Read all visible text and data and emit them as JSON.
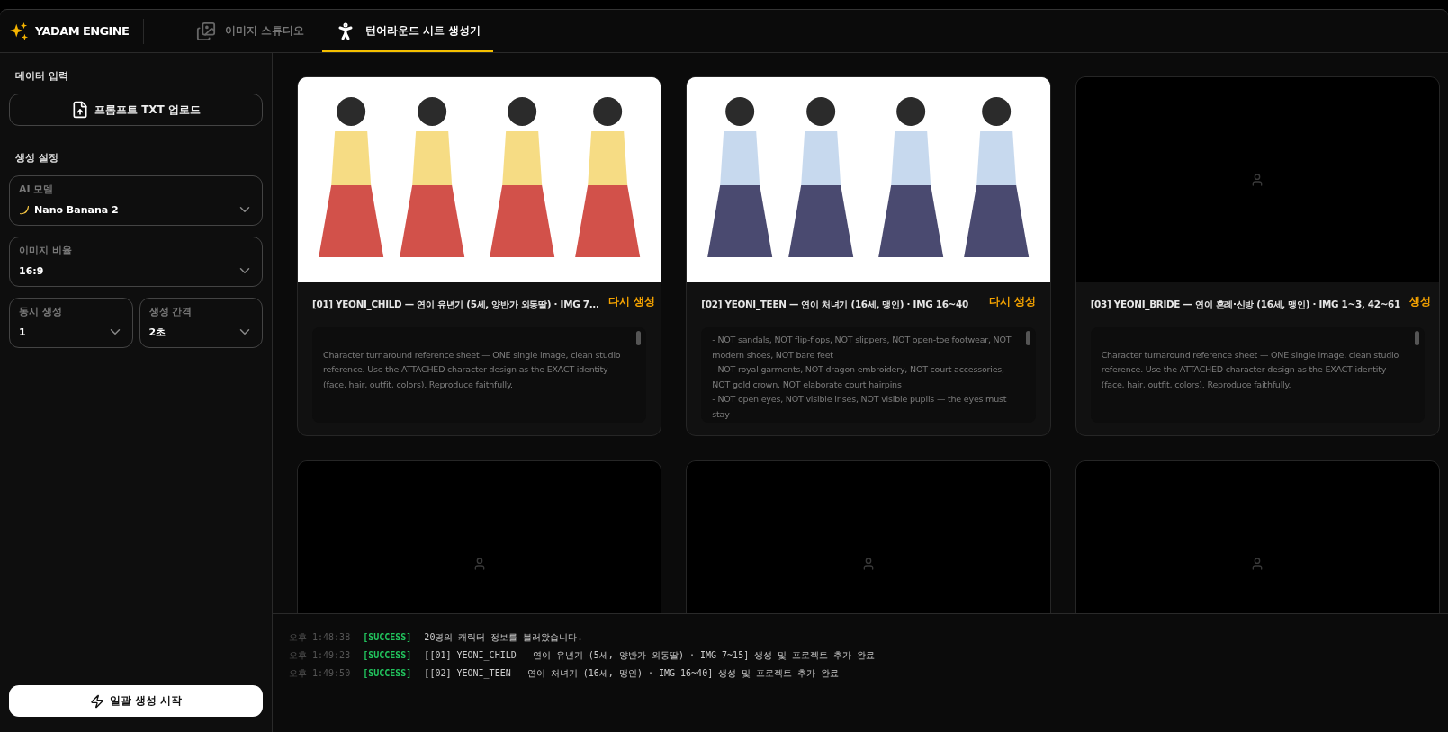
{
  "app": {
    "logo": "YADAM ENGINE"
  },
  "tabs": [
    {
      "label": "이미지 스튜디오",
      "kind": "studio",
      "selected": false
    },
    {
      "label": "턴어라운드 시트 생성기",
      "kind": "turnaround",
      "selected": true
    }
  ],
  "sidebar": {
    "data_title": "데이터 입력",
    "upload_button": "프롬프트 TXT 업로드",
    "settings_title": "생성 설정",
    "fields": [
      {
        "label": "AI 모델",
        "value": "Nano Banana 2",
        "kind": "model"
      },
      {
        "label": "이미지 비율",
        "value": "16:9",
        "kind": "plain"
      }
    ],
    "small_fields": [
      {
        "label": "동시 생성",
        "value": "1"
      },
      {
        "label": "생성 간격",
        "value": "2초"
      }
    ],
    "start_button": "일괄 생성 시작"
  },
  "cards": [
    {
      "kind": "picture",
      "title": "[01] YEONI_CHILD — 연이 유년기 (5세, 양반가 외동딸) · IMG 7...",
      "action": "다시 생성",
      "prompt": [
        "____________________________________________________",
        "Character turnaround reference sheet — ONE single image, clean studio reference. Use the ATTACHED character design as the EXACT identity (face, hair, outfit, colors). Reproduce faithfully."
      ]
    },
    {
      "kind": "picture",
      "title": "[02] YEONI_TEEN — 연이 처녀기 (16세, 맹인) · IMG 16~40",
      "action": "다시 생성",
      "prompt": [
        "- NOT sandals, NOT flip-flops, NOT slippers, NOT open-toe footwear, NOT modern shoes, NOT bare feet",
        "- NOT royal garments, NOT dragon embroidery, NOT court accessories, NOT gold crown, NOT elaborate court hairpins",
        "- NOT open eyes, NOT visible irises, NOT visible pupils — the eyes must stay"
      ]
    },
    {
      "kind": "placeholder",
      "title": "[03] YEONI_BRIDE — 연이 혼례·신방 (16세, 맹인) · IMG 1~3, 42~61",
      "action": "생성",
      "prompt": [
        "____________________________________________________",
        "Character turnaround reference sheet — ONE single image, clean studio reference. Use the ATTACHED character design as the EXACT identity (face, hair, outfit, colors). Reproduce faithfully."
      ]
    },
    {
      "kind": "placeholder"
    },
    {
      "kind": "placeholder"
    },
    {
      "kind": "placeholder"
    }
  ],
  "log": [
    {
      "time": "오후 1:48:38",
      "level": "[SUCCESS]",
      "kind": "success",
      "message": "20명의 캐릭터 정보를 불러왔습니다."
    },
    {
      "time": "오후 1:49:23",
      "level": "[SUCCESS]",
      "kind": "success",
      "message": "[[01] YEONI_CHILD — 연이 유년기 (5세, 양반가 외동딸) · IMG 7~15] 생성 및 프로젝트 추가 완료"
    },
    {
      "time": "오후 1:49:50",
      "level": "[SUCCESS]",
      "kind": "success",
      "message": "[[02] YEONI_TEEN — 연이 처녀기 (16세, 맹인) · IMG 16~40] 생성 및 프로젝트 추가 완료"
    }
  ]
}
